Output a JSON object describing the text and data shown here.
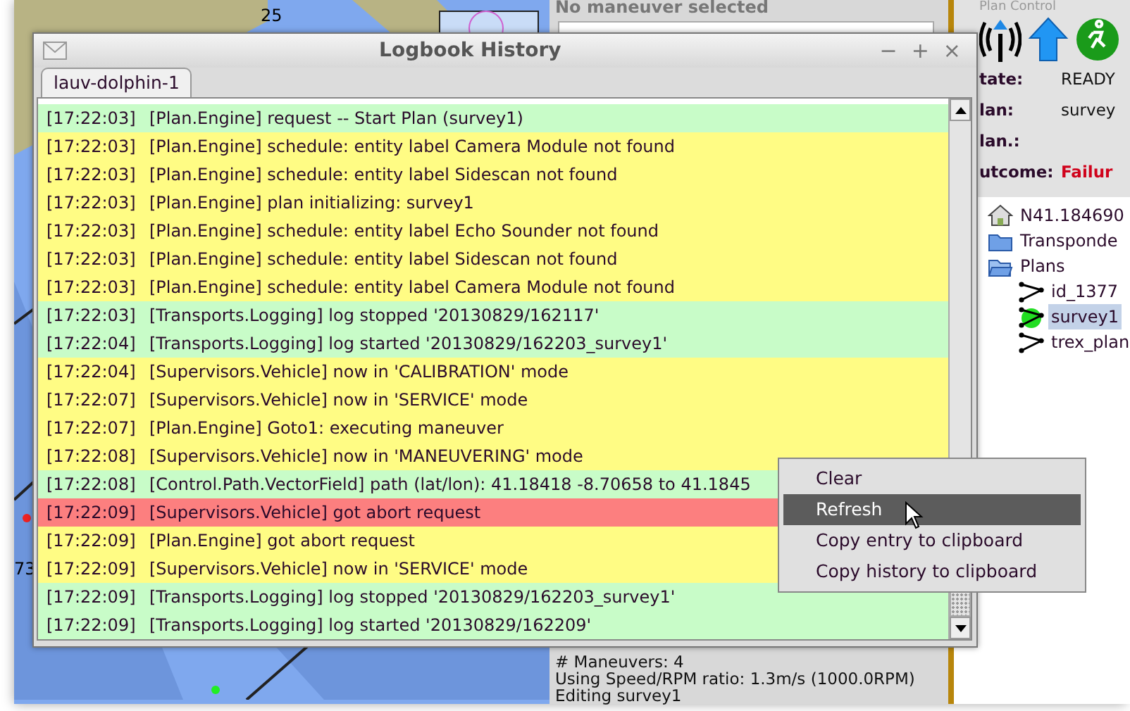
{
  "map": {
    "labels": [
      "25",
      "73"
    ]
  },
  "maneuver_panel": {
    "title": "No maneuver selected",
    "info_lines": [
      "# Maneuvers: 4",
      "Using Speed/RPM ratio: 1.3m/s (1000.0RPM)",
      "Editing survey1"
    ]
  },
  "plan_control": {
    "title": "Plan Control",
    "fields": [
      {
        "label": "tate:",
        "value": "READY",
        "alert": false
      },
      {
        "label": "lan:",
        "value": "survey",
        "alert": false
      },
      {
        "label": "lan.:"
      },
      {
        "label": "utcome:",
        "value": "Failur",
        "alert": true
      }
    ]
  },
  "tree": [
    {
      "label": "N41.184690",
      "kind": "home"
    },
    {
      "label": "Transponde",
      "kind": "folder"
    },
    {
      "label": "Plans",
      "kind": "folder-open",
      "expanded": true,
      "children": [
        {
          "label": "id_1377",
          "kind": "plan",
          "selected": false,
          "active": false
        },
        {
          "label": "survey1",
          "kind": "plan",
          "selected": true,
          "active": true
        },
        {
          "label": "trex_plan",
          "kind": "plan",
          "selected": false,
          "active": false
        }
      ]
    }
  ],
  "logbook": {
    "title": "Logbook History",
    "window_buttons": [
      "−",
      "+",
      "×"
    ],
    "tabs": [
      {
        "label": "lauv-dolphin-1",
        "selected": true
      }
    ],
    "entries": [
      {
        "time": "[17:22:03]",
        "message": "[Plan.Engine] request -- Start Plan (survey1)",
        "kind": "info"
      },
      {
        "time": "[17:22:03]",
        "message": "[Plan.Engine] schedule: entity label Camera Module not found",
        "kind": "warning"
      },
      {
        "time": "[17:22:03]",
        "message": "[Plan.Engine] schedule: entity label Sidescan not found",
        "kind": "warning"
      },
      {
        "time": "[17:22:03]",
        "message": "[Plan.Engine] plan initializing: survey1",
        "kind": "warning"
      },
      {
        "time": "[17:22:03]",
        "message": "[Plan.Engine] schedule: entity label Echo Sounder not found",
        "kind": "warning"
      },
      {
        "time": "[17:22:03]",
        "message": "[Plan.Engine] schedule: entity label Sidescan not found",
        "kind": "warning"
      },
      {
        "time": "[17:22:03]",
        "message": "[Plan.Engine] schedule: entity label Camera Module not found",
        "kind": "warning"
      },
      {
        "time": "[17:22:03]",
        "message": "[Transports.Logging] log stopped '20130829/162117'",
        "kind": "info"
      },
      {
        "time": "[17:22:04]",
        "message": "[Transports.Logging] log started '20130829/162203_survey1'",
        "kind": "info"
      },
      {
        "time": "[17:22:04]",
        "message": "[Supervisors.Vehicle] now in 'CALIBRATION' mode",
        "kind": "warning"
      },
      {
        "time": "[17:22:07]",
        "message": "[Supervisors.Vehicle] now in 'SERVICE' mode",
        "kind": "warning"
      },
      {
        "time": "[17:22:07]",
        "message": "[Plan.Engine] Goto1: executing maneuver",
        "kind": "warning"
      },
      {
        "time": "[17:22:08]",
        "message": "[Supervisors.Vehicle] now in 'MANEUVERING' mode",
        "kind": "warning"
      },
      {
        "time": "[17:22:08]",
        "message": "[Control.Path.VectorField] path (lat/lon): 41.18418 -8.70658 to 41.1845",
        "kind": "info"
      },
      {
        "time": "[17:22:09]",
        "message": "[Supervisors.Vehicle] got abort request",
        "kind": "error"
      },
      {
        "time": "[17:22:09]",
        "message": "[Plan.Engine] got abort request",
        "kind": "warning"
      },
      {
        "time": "[17:22:09]",
        "message": "[Supervisors.Vehicle] now in 'SERVICE' mode",
        "kind": "warning"
      },
      {
        "time": "[17:22:09]",
        "message": "[Transports.Logging] log stopped '20130829/162203_survey1'",
        "kind": "info"
      },
      {
        "time": "[17:22:09]",
        "message": "[Transports.Logging] log started '20130829/162209'",
        "kind": "info"
      }
    ]
  },
  "context_menu": {
    "items": [
      {
        "label": "Clear",
        "selected": false
      },
      {
        "label": "Refresh",
        "selected": true
      },
      {
        "label": "Copy entry to clipboard",
        "selected": false
      },
      {
        "label": "Copy history to clipboard",
        "selected": false
      }
    ]
  }
}
